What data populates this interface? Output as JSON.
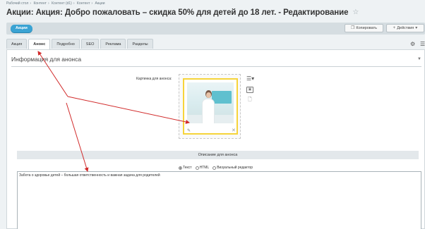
{
  "breadcrumb": [
    "Рабочий стол",
    "Контент",
    "Контент (d1)",
    "Контент",
    "Акции"
  ],
  "page_title": "Акции: Акция: Добро пожаловать – скидка 50% для детей до 18 лет. - Редактирование",
  "toolbar": {
    "actions_label": "Акции",
    "copy_label": "Копировать",
    "more_label": "Действия"
  },
  "tabs": [
    "Акция",
    "Анонс",
    "Подробно",
    "SEO",
    "Реклама",
    "Разделы"
  ],
  "active_tab": "Анонс",
  "section": {
    "title": "Информация для анонса"
  },
  "picture": {
    "label": "Картинка для анонса:"
  },
  "description": {
    "header": "Описание для анонса",
    "modes": [
      {
        "label": "Текст",
        "selected": true
      },
      {
        "label": "HTML",
        "selected": false
      },
      {
        "label": "Визуальный редактор",
        "selected": false
      }
    ],
    "text": "Забота о здоровье детей – большая ответственность и важная задача для родителей"
  },
  "colors": {
    "accent": "#3aa3d3",
    "annotation_arrow": "#d12a2a",
    "picture_frame": "#f6d43a"
  }
}
